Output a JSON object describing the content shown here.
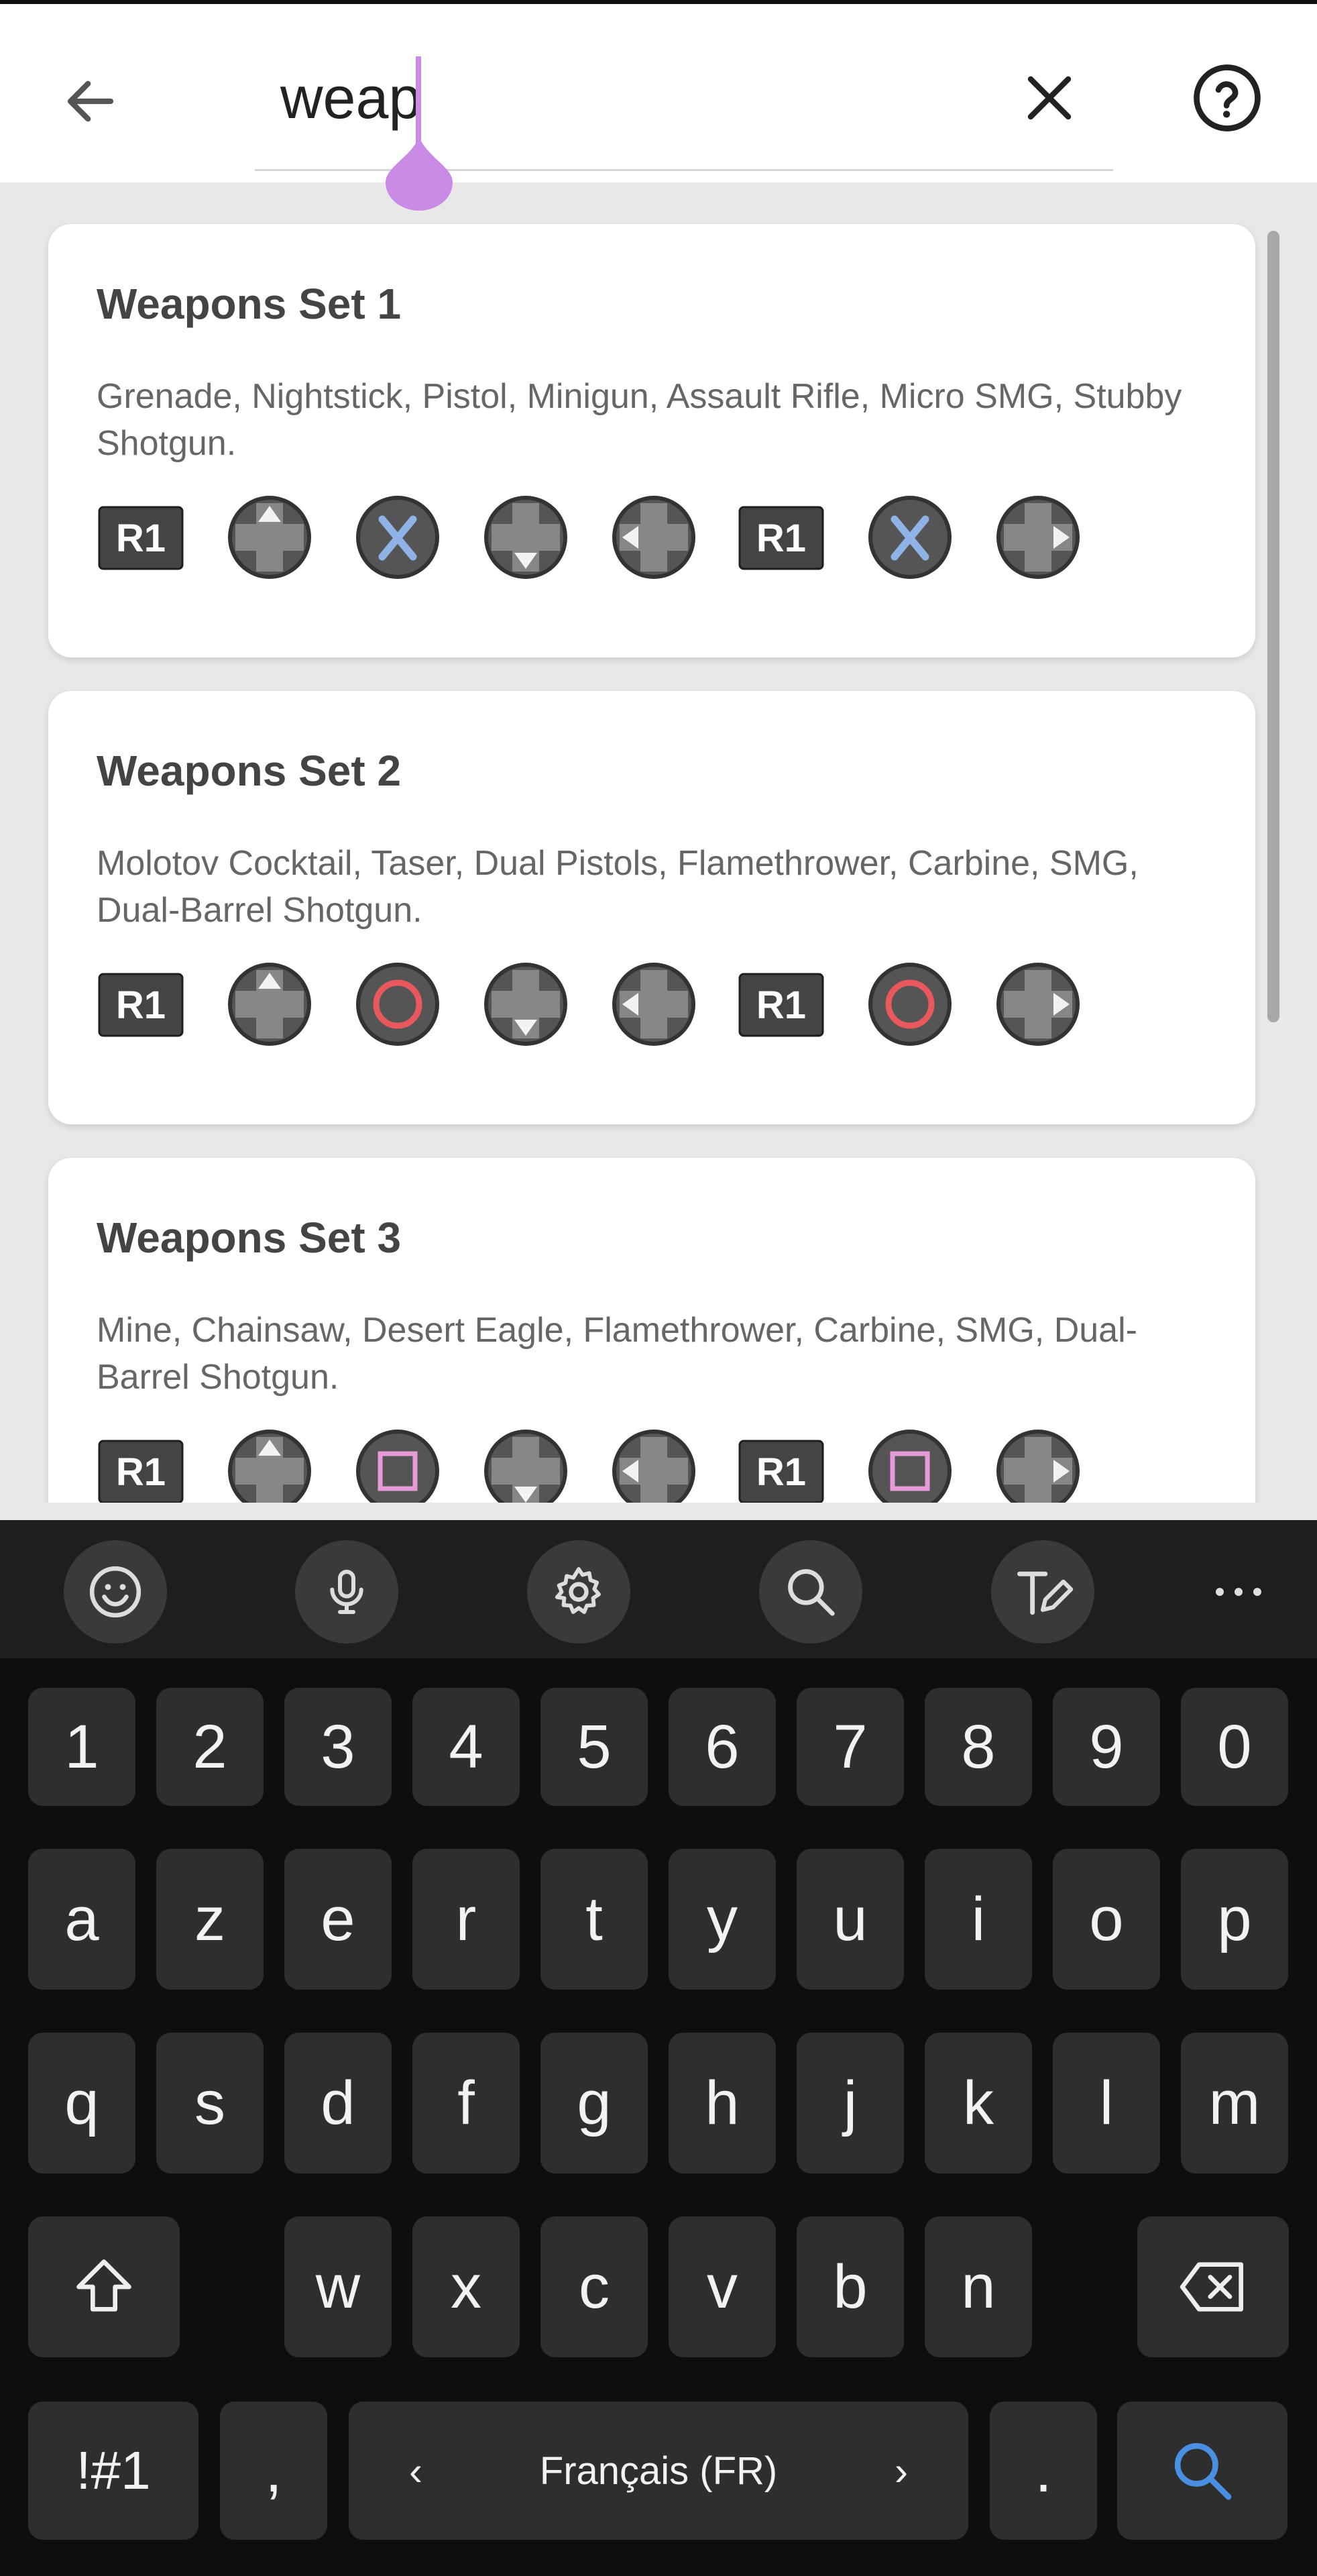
{
  "search": {
    "query": "weap"
  },
  "header": {
    "back_icon": "arrow-left-icon",
    "clear_icon": "close-icon",
    "help_icon": "help-circle-icon"
  },
  "cards": [
    {
      "title": "Weapons Set 1",
      "description": "Grenade, Nightstick, Pistol, Minigun, Assault Rifle, Micro SMG, Stubby Shotgun.",
      "buttons": [
        "R1",
        "dpad-up",
        "cross",
        "dpad-down",
        "dpad-left",
        "R1",
        "cross",
        "dpad-right"
      ]
    },
    {
      "title": "Weapons Set 2",
      "description": "Molotov Cocktail, Taser, Dual Pistols, Flamethrower, Carbine, SMG, Dual-Barrel Shotgun.",
      "buttons": [
        "R1",
        "dpad-up",
        "circle",
        "dpad-down",
        "dpad-left",
        "R1",
        "circle",
        "dpad-right"
      ]
    },
    {
      "title": "Weapons Set 3",
      "description": "Mine, Chainsaw, Desert Eagle, Flamethrower, Carbine, SMG, Dual-Barrel Shotgun.",
      "buttons": [
        "R1",
        "dpad-up",
        "square",
        "dpad-down",
        "dpad-left",
        "R1",
        "square",
        "dpad-right"
      ]
    }
  ],
  "colors": {
    "cross": "#8fb3e6",
    "circle": "#e8585c",
    "square": "#e69ad8",
    "accent": "#c98be6"
  },
  "keyboard": {
    "toolbar": [
      "emoji-icon",
      "microphone-icon",
      "settings-icon",
      "search-icon",
      "handwriting-icon",
      "more-icon"
    ],
    "rows": [
      [
        "1",
        "2",
        "3",
        "4",
        "5",
        "6",
        "7",
        "8",
        "9",
        "0"
      ],
      [
        "a",
        "z",
        "e",
        "r",
        "t",
        "y",
        "u",
        "i",
        "o",
        "p"
      ],
      [
        "q",
        "s",
        "d",
        "f",
        "g",
        "h",
        "j",
        "k",
        "l",
        "m"
      ],
      [
        "shift",
        "w",
        "x",
        "c",
        "v",
        "b",
        "n",
        "backspace"
      ]
    ],
    "bottom": {
      "symbols": "!#1",
      "comma": ",",
      "space_label": "Français (FR)",
      "space_prev": "‹",
      "space_next": "›",
      "period": ".",
      "action_icon": "search-icon"
    }
  }
}
